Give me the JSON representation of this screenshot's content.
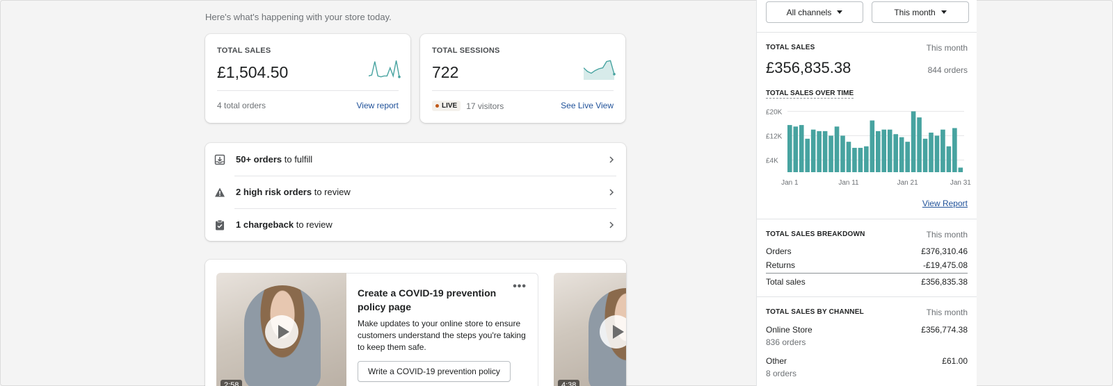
{
  "main": {
    "subtitle": "Here's what's happening with your store today.",
    "total_sales_card": {
      "label": "TOTAL SALES",
      "value": "£1,504.50",
      "footer": "4 total orders",
      "link": "View report"
    },
    "total_sessions_card": {
      "label": "TOTAL SESSIONS",
      "value": "722",
      "badge": "LIVE",
      "footer": "17 visitors",
      "link": "See Live View"
    },
    "tasks": [
      {
        "icon": "download-box-icon",
        "bold": "50+ orders",
        "rest": " to fulfill"
      },
      {
        "icon": "warning-icon",
        "bold": "2 high risk orders",
        "rest": " to review"
      },
      {
        "icon": "clipboard-icon",
        "bold": "1 chargeback",
        "rest": " to review"
      }
    ],
    "video_card": {
      "duration_1": "2:58",
      "duration_2": "4:38",
      "title": "Create a COVID-19 prevention policy page",
      "description": "Make updates to your online store to ensure customers understand the steps you're taking to keep them safe.",
      "more": "•••",
      "button": "Write a COVID-19 prevention policy"
    }
  },
  "panel": {
    "channel_filter": "All channels",
    "period_filter": "This month",
    "total_sales": {
      "label": "TOTAL SALES",
      "period": "This month",
      "value": "£356,835.38",
      "orders": "844 orders",
      "chart_title": "TOTAL SALES OVER TIME",
      "view_report": "View Report"
    },
    "breakdown": {
      "label": "TOTAL SALES BREAKDOWN",
      "period": "This month",
      "rows": [
        {
          "label": "Orders",
          "value": "£376,310.46"
        },
        {
          "label": "Returns",
          "value": "-£19,475.08"
        },
        {
          "label": "Total sales",
          "value": "£356,835.38"
        }
      ]
    },
    "by_channel": {
      "label": "TOTAL SALES BY CHANNEL",
      "period": "This month",
      "channels": [
        {
          "name": "Online Store",
          "value": "£356,774.38",
          "orders": "836 orders"
        },
        {
          "name": "Other",
          "value": "£61.00",
          "orders": "8 orders"
        }
      ]
    }
  },
  "chart_data": {
    "type": "bar",
    "title": "TOTAL SALES OVER TIME",
    "x_tick_labels": [
      "Jan 1",
      "Jan 11",
      "Jan 21",
      "Jan 31"
    ],
    "y_tick_labels": [
      "£20K",
      "£12K",
      "£4K"
    ],
    "y_ticks": [
      20000,
      12000,
      4000
    ],
    "ylim": [
      0,
      21000
    ],
    "grid": true,
    "color": "#47a3a0",
    "categories": [
      "Jan 1",
      "Jan 2",
      "Jan 3",
      "Jan 4",
      "Jan 5",
      "Jan 6",
      "Jan 7",
      "Jan 8",
      "Jan 9",
      "Jan 10",
      "Jan 11",
      "Jan 12",
      "Jan 13",
      "Jan 14",
      "Jan 15",
      "Jan 16",
      "Jan 17",
      "Jan 18",
      "Jan 19",
      "Jan 20",
      "Jan 21",
      "Jan 22",
      "Jan 23",
      "Jan 24",
      "Jan 25",
      "Jan 26",
      "Jan 27",
      "Jan 28",
      "Jan 29",
      "Jan 30",
      "Jan 31"
    ],
    "values": [
      15500,
      15000,
      15500,
      11000,
      14000,
      13500,
      13500,
      12000,
      15000,
      12000,
      10000,
      8000,
      8000,
      8500,
      17000,
      13500,
      14000,
      14000,
      12500,
      11500,
      10000,
      20000,
      18000,
      11000,
      13000,
      12000,
      14000,
      8500,
      14500,
      1500
    ]
  },
  "sparklines": {
    "sales": [
      0.1,
      0.15,
      0.9,
      0.1,
      0.05,
      0.1,
      0.1,
      0.55,
      0.1,
      0.95,
      0.05
    ],
    "sessions": [
      0.55,
      0.35,
      0.25,
      0.4,
      0.5,
      0.55,
      0.9,
      0.95,
      0.2
    ]
  },
  "colors": {
    "accent": "#47a3a0",
    "link": "#1f5199",
    "live_dot": "#c05717"
  }
}
